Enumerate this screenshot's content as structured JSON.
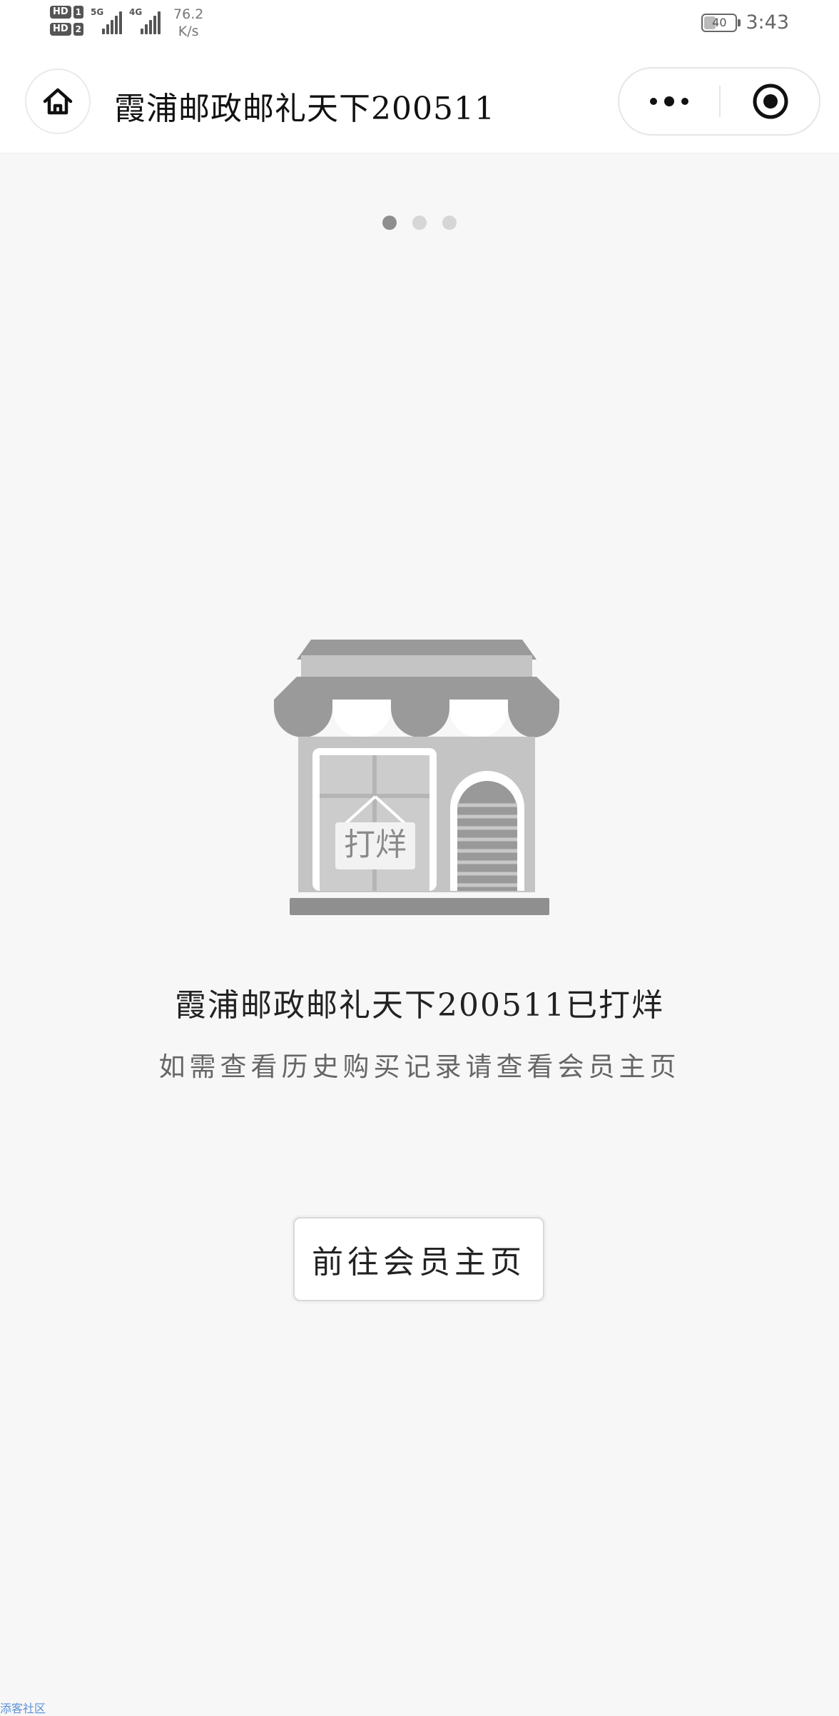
{
  "status_bar": {
    "hd1": "HD",
    "hd1_num": "1",
    "hd2": "HD",
    "hd2_num": "2",
    "signal1_label": "5G",
    "signal2_label": "4G",
    "net_speed_value": "76.2",
    "net_speed_unit": "K/s",
    "battery_level": "40",
    "time": "3:43"
  },
  "navbar": {
    "title": "霞浦邮政邮礼天下200511",
    "icons": {
      "home": "home-icon",
      "more": "more-dots-icon",
      "close": "target-close-icon"
    }
  },
  "carousel": {
    "dot_count": 3,
    "active_index": 0
  },
  "illustration": {
    "sign_text": "打烊",
    "icon": "closed-store-icon"
  },
  "content": {
    "title": "霞浦邮政邮礼天下200511已打烊",
    "subtitle": "如需查看历史购买记录请查看会员主页",
    "button_label": "前往会员主页"
  },
  "footer": {
    "link_text": "添客社区"
  },
  "colors": {
    "background": "#f7f7f7",
    "text": "#222222",
    "subtext": "#666666",
    "link": "#5b8fd6"
  }
}
